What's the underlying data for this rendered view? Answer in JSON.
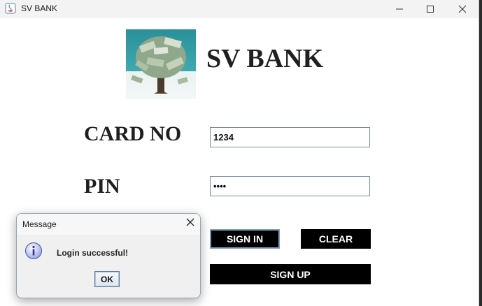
{
  "window": {
    "title": "SV BANK",
    "controls": {
      "minimize": "minimize-icon",
      "maximize": "maximize-icon",
      "close": "close-icon"
    }
  },
  "header": {
    "logo": "money-tree-logo",
    "title": "SV BANK"
  },
  "form": {
    "card_label": "CARD NO",
    "card_value": "1234",
    "pin_label": "PIN",
    "pin_value": "••••"
  },
  "buttons": {
    "sign_in": "SIGN IN",
    "clear": "CLEAR",
    "sign_up": "SIGN UP"
  },
  "dialog": {
    "title": "Message",
    "icon": "info-icon",
    "message": "Login successful!",
    "ok_label": "OK"
  },
  "colors": {
    "button_bg": "#000000",
    "button_text": "#ffffff",
    "focus_border": "#7d9ec0"
  }
}
